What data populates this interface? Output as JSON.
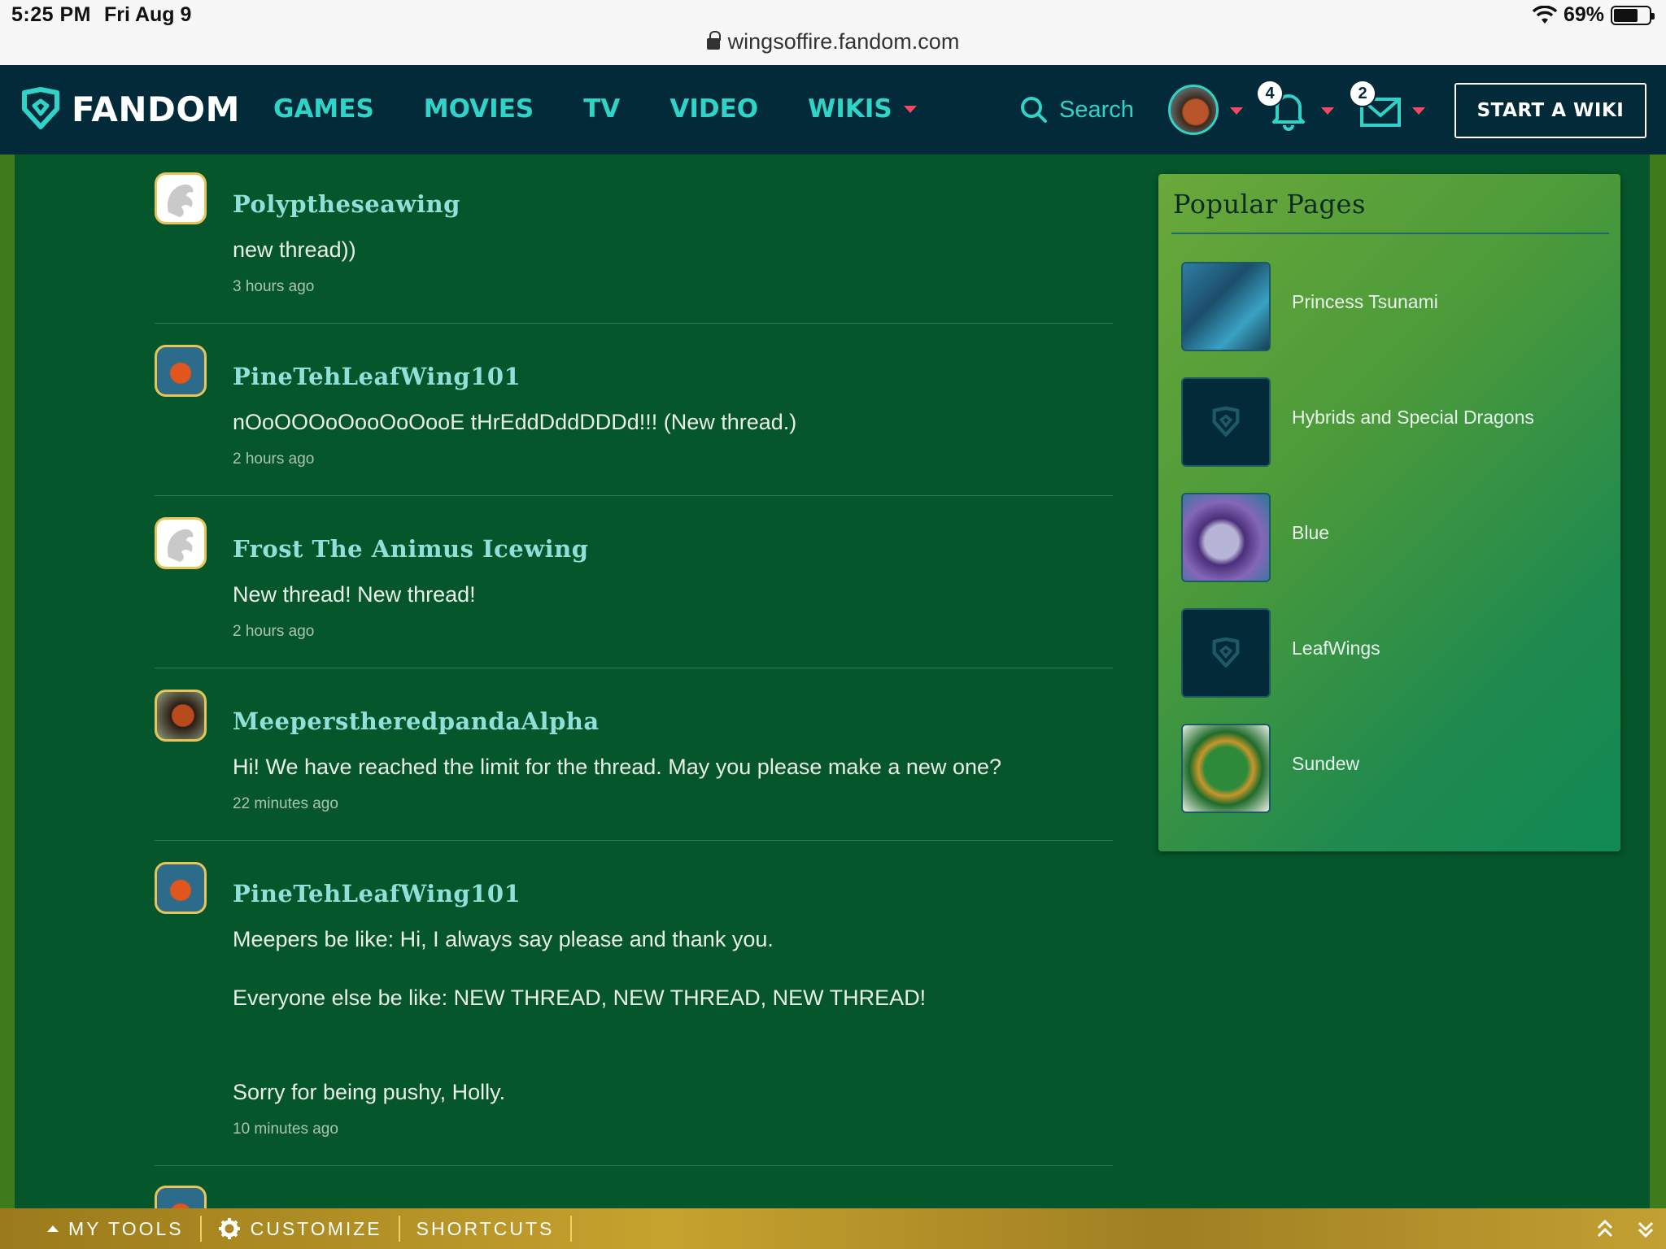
{
  "status_bar": {
    "time": "5:25 PM",
    "date": "Fri Aug 9",
    "battery": "69%",
    "battery_level": 0.69,
    "url": "wingsoffire.fandom.com"
  },
  "nav": {
    "logo_text": "FANDOM",
    "links": [
      "GAMES",
      "MOVIES",
      "TV",
      "VIDEO",
      "WIKIS"
    ],
    "search_label": "Search",
    "notifications_count": "4",
    "messages_count": "2",
    "start_wiki_label": "START A WIKI",
    "accent_color": "#2fd3c7",
    "bar_color": "#032a38"
  },
  "thread": [
    {
      "user": "Polyptheseawing",
      "avatar": "dragon",
      "lines": [
        "new thread))"
      ],
      "time": "3 hours ago"
    },
    {
      "user": "PineTehLeafWing101",
      "avatar": "fox",
      "lines": [
        "nOoOOOoOooOoOooE tHrEddDddDDDd!!! (New thread.)"
      ],
      "time": "2 hours ago"
    },
    {
      "user": "Frost The Animus Icewing",
      "avatar": "dragon",
      "lines": [
        "New thread! New thread!"
      ],
      "time": "2 hours ago"
    },
    {
      "user": "MeeperstheredpandaAlpha",
      "avatar": "panda",
      "lines": [
        "Hi! We have reached the limit for the thread. May you please make a new one?"
      ],
      "time": "22 minutes ago"
    },
    {
      "user": "PineTehLeafWing101",
      "avatar": "fox",
      "lines": [
        "Meepers be like: Hi, I always say please and thank you.",
        "Everyone else be like: NEW THREAD, NEW THREAD, NEW THREAD!",
        "Sorry for being pushy, Holly."
      ],
      "time": "10 minutes ago"
    }
  ],
  "popular_pages": {
    "title": "Popular Pages",
    "items": [
      {
        "label": "Princess Tsunami",
        "thumb": "tsunami"
      },
      {
        "label": "Hybrids and Special Dragons",
        "thumb": "default"
      },
      {
        "label": "Blue",
        "thumb": "blue"
      },
      {
        "label": "LeafWings",
        "thumb": "default"
      },
      {
        "label": "Sundew",
        "thumb": "sundew"
      }
    ]
  },
  "toolbar": {
    "my_tools": "MY TOOLS",
    "customize": "CUSTOMIZE",
    "shortcuts": "SHORTCUTS"
  }
}
